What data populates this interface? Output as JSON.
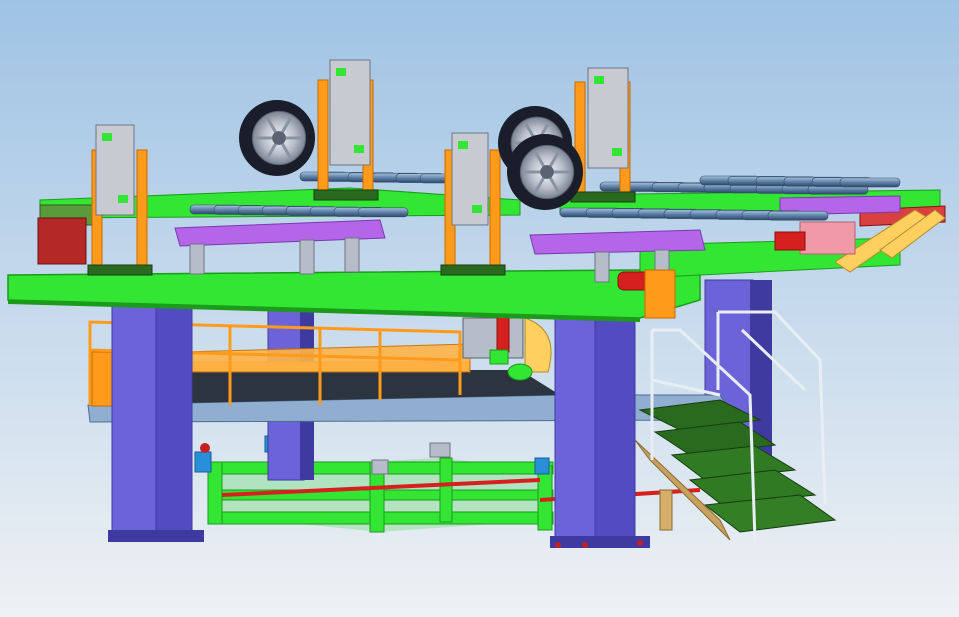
{
  "scene": {
    "subject": "cad-assembly",
    "background_top": "#9fc3e4",
    "background_bottom": "#eef1f4",
    "colors": {
      "frame_green": "#33e633",
      "frame_green_dark": "#1c9a1c",
      "column_purple": "#6c63d9",
      "column_purple_dark": "#3f3aa0",
      "orange": "#ff9a1a",
      "orange_dark": "#c86a00",
      "magenta_beam": "#b566e8",
      "pink": "#ef9aa6",
      "red": "#d63030",
      "yellow": "#ffd060",
      "gray_motor": "#c8cad2",
      "roller_blue": "#6d8fb5",
      "dark_green_stairs": "#2a6a1f",
      "rail": "#e8eef4",
      "deck": "#2c3440",
      "tire": "#1a1d2a",
      "rim": "#c8ccd6"
    }
  }
}
